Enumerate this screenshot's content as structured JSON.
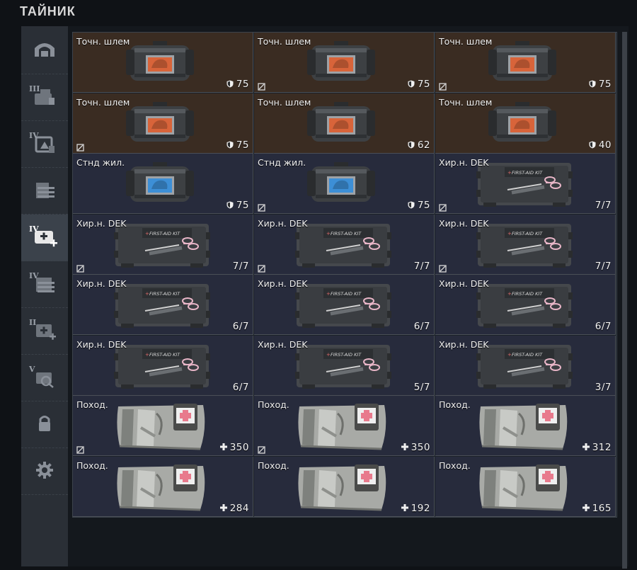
{
  "title": "ТАЙНИК",
  "sidebar": {
    "items": [
      {
        "icon": "shelter-icon",
        "tier": ""
      },
      {
        "icon": "helmet-tier-icon",
        "tier": "III"
      },
      {
        "icon": "armor-tier-icon",
        "tier": "IV"
      },
      {
        "icon": "backpack-tier-icon",
        "tier": ""
      },
      {
        "icon": "medkit-plus-icon",
        "tier": "IV"
      },
      {
        "icon": "supply-tier-icon",
        "tier": "IV"
      },
      {
        "icon": "medkit-tier-icon",
        "tier": "II"
      },
      {
        "icon": "scope-tier-icon",
        "tier": "V"
      },
      {
        "icon": "lock-icon",
        "tier": ""
      },
      {
        "icon": "gear-icon",
        "tier": ""
      }
    ]
  },
  "items": [
    {
      "name": "Точн. шлем",
      "type": "helmet",
      "value": "75",
      "glyph": "shield",
      "tag": false
    },
    {
      "name": "Точн. шлем",
      "type": "helmet",
      "value": "75",
      "glyph": "shield",
      "tag": true
    },
    {
      "name": "Точн. шлем",
      "type": "helmet",
      "value": "75",
      "glyph": "shield",
      "tag": true
    },
    {
      "name": "Точн. шлем",
      "type": "helmet",
      "value": "75",
      "glyph": "shield",
      "tag": true
    },
    {
      "name": "Точн. шлем",
      "type": "helmet",
      "value": "62",
      "glyph": "shield",
      "tag": false
    },
    {
      "name": "Точн. шлем",
      "type": "helmet",
      "value": "40",
      "glyph": "shield",
      "tag": false
    },
    {
      "name": "Стнд жил.",
      "type": "vest",
      "value": "75",
      "glyph": "shield",
      "tag": false
    },
    {
      "name": "Стнд жил.",
      "type": "vest",
      "value": "75",
      "glyph": "shield",
      "tag": true
    },
    {
      "name": "Хир.н. DEK",
      "type": "kit",
      "value": "7/7",
      "glyph": "",
      "tag": true
    },
    {
      "name": "Хир.н. DEK",
      "type": "kit",
      "value": "7/7",
      "glyph": "",
      "tag": true
    },
    {
      "name": "Хир.н. DEK",
      "type": "kit",
      "value": "7/7",
      "glyph": "",
      "tag": true
    },
    {
      "name": "Хир.н. DEK",
      "type": "kit",
      "value": "7/7",
      "glyph": "",
      "tag": true
    },
    {
      "name": "Хир.н. DEK",
      "type": "kit",
      "value": "6/7",
      "glyph": "",
      "tag": false
    },
    {
      "name": "Хир.н. DEK",
      "type": "kit",
      "value": "6/7",
      "glyph": "",
      "tag": false
    },
    {
      "name": "Хир.н. DEK",
      "type": "kit",
      "value": "6/7",
      "glyph": "",
      "tag": false
    },
    {
      "name": "Хир.н. DEK",
      "type": "kit",
      "value": "6/7",
      "glyph": "",
      "tag": false
    },
    {
      "name": "Хир.н. DEK",
      "type": "kit",
      "value": "5/7",
      "glyph": "",
      "tag": false
    },
    {
      "name": "Хир.н. DEK",
      "type": "kit",
      "value": "3/7",
      "glyph": "",
      "tag": false
    },
    {
      "name": "Поход.",
      "type": "pouch",
      "value": "350",
      "glyph": "plus",
      "tag": true
    },
    {
      "name": "Поход.",
      "type": "pouch",
      "value": "350",
      "glyph": "plus",
      "tag": true
    },
    {
      "name": "Поход.",
      "type": "pouch",
      "value": "312",
      "glyph": "plus",
      "tag": false
    },
    {
      "name": "Поход.",
      "type": "pouch",
      "value": "284",
      "glyph": "plus",
      "tag": false
    },
    {
      "name": "Поход.",
      "type": "pouch",
      "value": "192",
      "glyph": "plus",
      "tag": false
    },
    {
      "name": "Поход.",
      "type": "pouch",
      "value": "165",
      "glyph": "plus",
      "tag": false
    }
  ],
  "colors": {
    "helmet_bg": "#3a2c22",
    "other_bg": "#272b3c",
    "accent_orange": "#d8643a",
    "accent_blue": "#3d8fd6"
  }
}
